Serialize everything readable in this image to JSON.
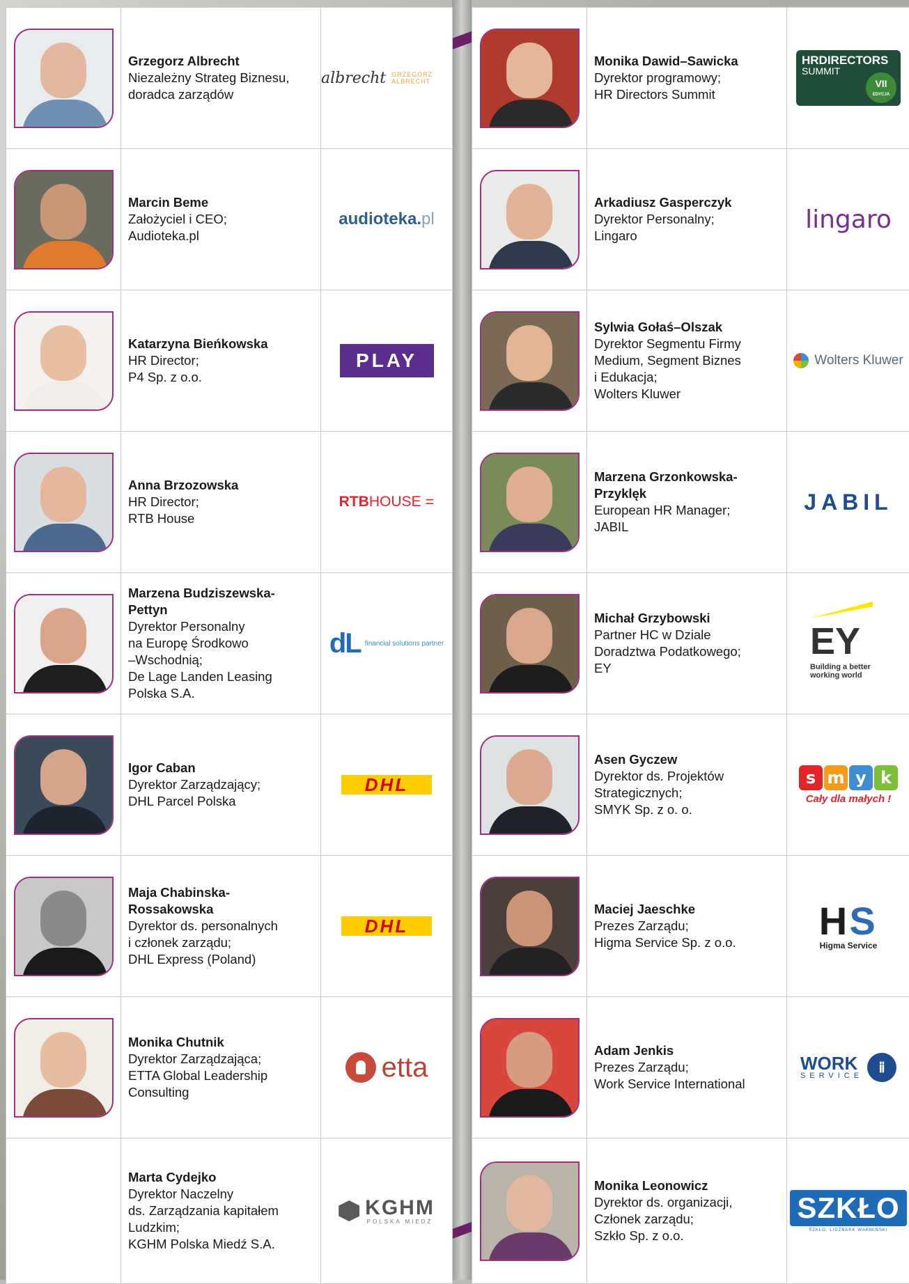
{
  "colors": {
    "accent_border": "#a0307f",
    "grid_line": "#c8c8c8",
    "background": "#b9bbb6"
  },
  "left_column": [
    {
      "name": "Grzegorz Albrecht",
      "lines": [
        "Niezależny Strateg Biznesu,",
        "doradca zarządów"
      ],
      "logo": {
        "type": "albrecht",
        "text": "albrecht",
        "subtext": "GRZEGORZ ALBRECHT"
      }
    },
    {
      "name": "Marcin Beme",
      "lines": [
        "Założyciel i CEO;",
        "Audioteka.pl"
      ],
      "logo": {
        "type": "audioteka",
        "text": "audioteka.",
        "subtext": "pl"
      }
    },
    {
      "name": "Katarzyna Bieńkowska",
      "lines": [
        "HR Director;",
        "P4 Sp. z o.o."
      ],
      "logo": {
        "type": "play",
        "text": "PLAY"
      }
    },
    {
      "name": "Anna Brzozowska",
      "lines": [
        "HR Director;",
        "RTB House"
      ],
      "logo": {
        "type": "rtb",
        "text": "RTB",
        "subtext": "HOUSE",
        "mark": "="
      }
    },
    {
      "name": "Marzena Budziszewska-Pettyn",
      "lines": [
        "Dyrektor Personalny",
        "na Europę Środkowo",
        "–Wschodnią;",
        "De Lage Landen Leasing",
        "Polska S.A."
      ],
      "logo": {
        "type": "dll",
        "text": "dL",
        "subtext": "financial solutions partner"
      }
    },
    {
      "name": "Igor Caban",
      "lines": [
        "Dyrektor Zarządzający;",
        "DHL Parcel Polska"
      ],
      "logo": {
        "type": "dhl",
        "text": "DHL"
      }
    },
    {
      "name": "Maja Chabinska-Rossakowska",
      "lines": [
        "Dyrektor ds. personalnych",
        "i członek zarządu;",
        "DHL Express (Poland)"
      ],
      "logo": {
        "type": "dhl",
        "text": "DHL"
      }
    },
    {
      "name": "Monika Chutnik",
      "lines": [
        "Dyrektor Zarządzająca;",
        "ETTA Global Leadership",
        "Consulting"
      ],
      "logo": {
        "type": "etta",
        "text": "etta"
      }
    },
    {
      "name": "Marta Cydejko",
      "lines": [
        "Dyrektor Naczelny",
        "ds. Zarządzania kapitałem",
        "Ludzkim;",
        "KGHM Polska Miedź S.A."
      ],
      "logo": {
        "type": "kghm",
        "text": "KGHM",
        "subtext": "POLSKA MIEDŹ"
      }
    }
  ],
  "right_column": [
    {
      "name": "Monika Dawid–Sawicka",
      "lines": [
        "Dyrektor programowy;",
        "HR Directors Summit"
      ],
      "logo": {
        "type": "hrds",
        "text": "HRDIRECTORS",
        "subtext": "SUMMIT",
        "badge": "VII",
        "badge_sub": "EDYCJA"
      }
    },
    {
      "name": "Arkadiusz Gasperczyk",
      "lines": [
        "Dyrektor Personalny;",
        "Lingaro"
      ],
      "logo": {
        "type": "lingaro",
        "text": "lingaro"
      }
    },
    {
      "name": "Sylwia Gołaś–Olszak",
      "lines": [
        "Dyrektor Segmentu Firmy",
        "Medium, Segment Biznes",
        "i Edukacja;",
        "Wolters Kluwer"
      ],
      "logo": {
        "type": "wk",
        "text": "Wolters Kluwer"
      }
    },
    {
      "name": "Marzena Grzonkowska-Przyklęk",
      "lines": [
        "European HR Manager;",
        "JABIL"
      ],
      "logo": {
        "type": "jabil",
        "text": "JABIL"
      }
    },
    {
      "name": "Michał Grzybowski",
      "lines": [
        "Partner HC w Dziale",
        "Doradztwa Podatkowego;",
        "EY"
      ],
      "logo": {
        "type": "ey",
        "text": "EY",
        "subtext": "Building a better working world"
      }
    },
    {
      "name": "Asen Gyczew",
      "lines": [
        "Dyrektor ds. Projektów",
        "Strategicznych;",
        "SMYK Sp. z o. o."
      ],
      "logo": {
        "type": "smyk",
        "text": "smyk",
        "subtext": "Cały dla małych !"
      }
    },
    {
      "name": "Maciej Jaeschke",
      "lines": [
        "Prezes Zarządu;",
        "Higma Service Sp. z o.o."
      ],
      "logo": {
        "type": "higma",
        "text": "HS",
        "subtext": "Higma Service"
      }
    },
    {
      "name": "Adam Jenkis",
      "lines": [
        "Prezes Zarządu;",
        "Work Service International"
      ],
      "logo": {
        "type": "work",
        "text": "WORK",
        "subtext": "SERVICE"
      }
    },
    {
      "name": "Monika Leonowicz",
      "lines": [
        "Dyrektor ds. organizacji,",
        "Członek zarządu;",
        "Szkło Sp. z o.o."
      ],
      "logo": {
        "type": "szklo",
        "text": "SZKŁO",
        "subtext": "SZKŁO. LIDZBARK WARMIŃSKI"
      }
    }
  ]
}
